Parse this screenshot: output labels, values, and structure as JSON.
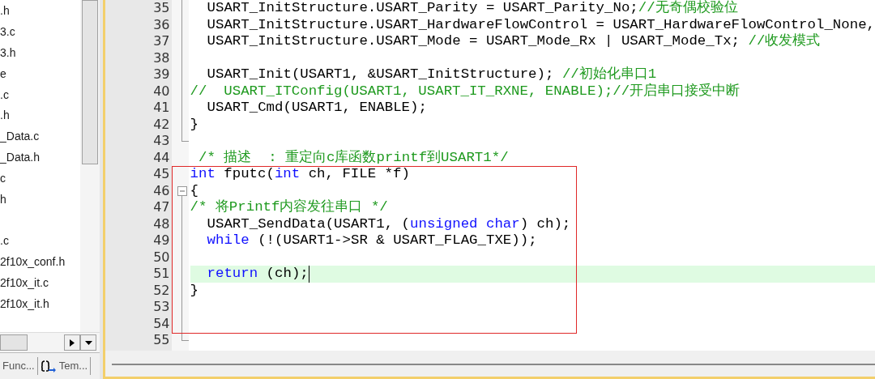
{
  "sidebar": {
    "files": [
      {
        "kind": "file",
        "label": ".h"
      },
      {
        "kind": "file",
        "label": "3.c"
      },
      {
        "kind": "file",
        "label": "3.h"
      },
      {
        "kind": "file",
        "label": "e"
      },
      {
        "kind": "file",
        "label": ".c"
      },
      {
        "kind": "file",
        "label": ".h"
      },
      {
        "kind": "file",
        "label": "_Data.c"
      },
      {
        "kind": "file",
        "label": "_Data.h"
      },
      {
        "kind": "file",
        "label": "c"
      },
      {
        "kind": "file",
        "label": "h"
      },
      {
        "kind": "spacer"
      },
      {
        "kind": "file",
        "label": ".c"
      },
      {
        "kind": "file",
        "label": "2f10x_conf.h"
      },
      {
        "kind": "file",
        "label": "2f10x_it.c"
      },
      {
        "kind": "file",
        "label": "2f10x_it.h"
      }
    ],
    "tabs": [
      {
        "label": "Func...",
        "kind": "functions",
        "selected": false
      },
      {
        "label": "Tem...",
        "kind": "templates",
        "selected": false
      }
    ]
  },
  "editor": {
    "lines": [
      {
        "number": "35",
        "indented": true,
        "segments": [
          {
            "kind": "plain",
            "text": "USART_InitStructure.USART_Parity = USART_Parity_No;"
          },
          {
            "kind": "comment",
            "text": "//无奇偶校验位"
          }
        ]
      },
      {
        "number": "36",
        "indented": true,
        "segments": [
          {
            "kind": "plain",
            "text": "USART_InitStructure.USART_HardwareFlowControl = USART_HardwareFlowControl_None,"
          }
        ]
      },
      {
        "number": "37",
        "indented": true,
        "segments": [
          {
            "kind": "plain",
            "text": "USART_InitStructure.USART_Mode = USART_Mode_Rx | USART_Mode_Tx; "
          },
          {
            "kind": "comment",
            "text": "//收发模式"
          }
        ]
      },
      {
        "number": "38"
      },
      {
        "number": "39",
        "indented": true,
        "segments": [
          {
            "kind": "plain",
            "text": "USART_Init(USART1, &USART_InitStructure); "
          },
          {
            "kind": "comment",
            "text": "//初始化串口1"
          }
        ]
      },
      {
        "number": "40",
        "indented": false,
        "segments": [
          {
            "kind": "comment",
            "text": "//  USART_ITConfig(USART1, USART_IT_RXNE, ENABLE);//开启串口接受中断"
          }
        ]
      },
      {
        "number": "41",
        "indented": true,
        "segments": [
          {
            "kind": "plain",
            "text": "USART_Cmd(USART1, ENABLE);"
          }
        ]
      },
      {
        "number": "42",
        "indented": false,
        "segments": [
          {
            "kind": "plain",
            "text": "}"
          }
        ]
      },
      {
        "number": "43",
        "block_end": true
      },
      {
        "number": "44",
        "indented": false,
        "segments": [
          {
            "kind": "comment",
            "text": " /* 描述  : 重定向c库函数printf到USART1*/"
          }
        ]
      },
      {
        "number": "45",
        "indented": false,
        "segments": [
          {
            "kind": "keyword",
            "text": "int"
          },
          {
            "kind": "plain",
            "text": " fputc("
          },
          {
            "kind": "keyword",
            "text": "int"
          },
          {
            "kind": "plain",
            "text": " ch, FILE *f)"
          }
        ]
      },
      {
        "number": "46",
        "indented": false,
        "fold": {
          "expanded": true
        },
        "segments": [
          {
            "kind": "plain",
            "text": "{"
          }
        ]
      },
      {
        "number": "47",
        "indented": false,
        "segments": [
          {
            "kind": "comment",
            "text": "/* 将Printf内容发往串口 */"
          }
        ]
      },
      {
        "number": "48",
        "indented": true,
        "segments": [
          {
            "kind": "plain",
            "text": "USART_SendData(USART1, ("
          },
          {
            "kind": "keyword",
            "text": "unsigned char"
          },
          {
            "kind": "plain",
            "text": ") ch);"
          }
        ]
      },
      {
        "number": "49",
        "indented": true,
        "segments": [
          {
            "kind": "keyword",
            "text": "while"
          },
          {
            "kind": "plain",
            "text": " (!(USART1->SR & USART_FLAG_TXE));"
          }
        ]
      },
      {
        "number": "50"
      },
      {
        "number": "51",
        "indented": true,
        "current": true,
        "segments": [
          {
            "kind": "keyword",
            "text": "return"
          },
          {
            "kind": "plain",
            "text": " (ch);"
          }
        ]
      },
      {
        "number": "52",
        "indented": false,
        "segments": [
          {
            "kind": "plain",
            "text": "}"
          }
        ]
      },
      {
        "number": "53"
      },
      {
        "number": "54"
      },
      {
        "number": "55",
        "block_end": true
      }
    ]
  }
}
